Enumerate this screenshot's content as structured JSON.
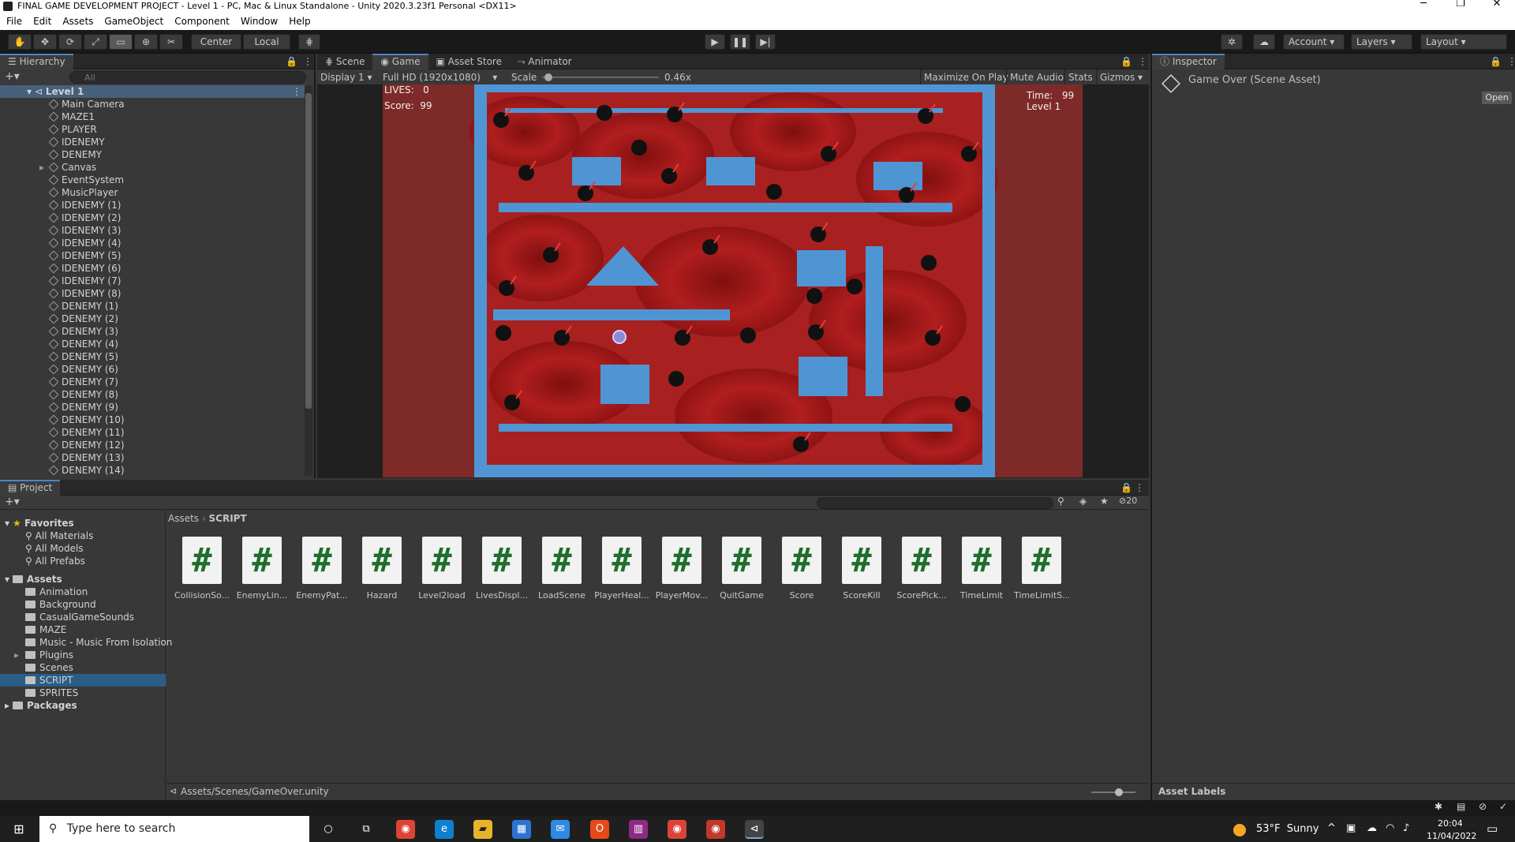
{
  "window": {
    "title": "FINAL GAME DEVELOPMENT PROJECT - Level 1 - PC, Mac & Linux Standalone - Unity 2020.3.23f1 Personal <DX11>",
    "minimize": "─",
    "restore": "❐",
    "close": "✕"
  },
  "menu": [
    "File",
    "Edit",
    "Assets",
    "GameObject",
    "Component",
    "Window",
    "Help"
  ],
  "toolbar": {
    "pivot_center": "Center",
    "pivot_local": "Local",
    "account": "Account",
    "layers": "Layers",
    "layout": "Layout"
  },
  "hierarchy": {
    "tab": "Hierarchy",
    "search_placeholder": "All",
    "scene": "Level 1",
    "items": [
      "Main Camera",
      "MAZE1",
      "PLAYER",
      "IDENEMY",
      "DENEMY",
      "Canvas",
      "EventSystem",
      "MusicPlayer",
      "IDENEMY (1)",
      "IDENEMY (2)",
      "IDENEMY (3)",
      "IDENEMY (4)",
      "IDENEMY (5)",
      "IDENEMY (6)",
      "IDENEMY (7)",
      "IDENEMY (8)",
      "DENEMY (1)",
      "DENEMY (2)",
      "DENEMY (3)",
      "DENEMY (4)",
      "DENEMY (5)",
      "DENEMY (6)",
      "DENEMY (7)",
      "DENEMY (8)",
      "DENEMY (9)",
      "DENEMY (10)",
      "DENEMY (11)",
      "DENEMY (12)",
      "DENEMY (13)",
      "DENEMY (14)"
    ]
  },
  "tabs": [
    "Scene",
    "Game",
    "Asset Store",
    "Animator"
  ],
  "game_toolbar": {
    "display": "Display 1",
    "resolution": "Full HD (1920x1080)",
    "scale_label": "Scale",
    "scale_value": "0.46x",
    "scale_fraction": 0.02,
    "maximize": "Maximize On Play",
    "mute": "Mute Audio",
    "stats": "Stats",
    "gizmos": "Gizmos"
  },
  "hud": {
    "lives_label": "LIVES:",
    "lives_value": "0",
    "score_label": "Score:",
    "score_value": "99",
    "time_label": "Time:",
    "time_value": "99",
    "level": "Level 1"
  },
  "inspector": {
    "tab": "Inspector",
    "asset": "Game Over (Scene Asset)",
    "open": "Open",
    "asset_labels": "Asset Labels"
  },
  "project": {
    "tab": "Project",
    "hidden_count": "20",
    "favorites": "Favorites",
    "favorite_items": [
      "All Materials",
      "All Models",
      "All Prefabs"
    ],
    "assets": "Assets",
    "folders": [
      "Animation",
      "Background",
      "CasualGameSounds",
      "MAZE",
      "Music - Music From Isolation",
      "Plugins",
      "Scenes",
      "SCRIPT",
      "SPRITES"
    ],
    "packages": "Packages",
    "breadcrumb_root": "Assets",
    "breadcrumb_current": "SCRIPT",
    "files": [
      "CollisionSo...",
      "EnemyLin...",
      "EnemyPat...",
      "Hazard",
      "Level2load",
      "LivesDispl...",
      "LoadScene",
      "PlayerHeal...",
      "PlayerMov...",
      "QuitGame",
      "Score",
      "ScoreKill",
      "ScorePick...",
      "TimeLimit",
      "TimeLimitS..."
    ],
    "file_glyph": "#",
    "status_path": "Assets/Scenes/GameOver.unity"
  },
  "taskbar": {
    "search_placeholder": "Type here to search",
    "weather": "53°F  Sunny",
    "time": "20:04",
    "date": "11/04/2022"
  },
  "colors": {
    "maze_blue": "#4f95d4",
    "selection": "#2c5d87",
    "blood": "#a51c1c"
  }
}
